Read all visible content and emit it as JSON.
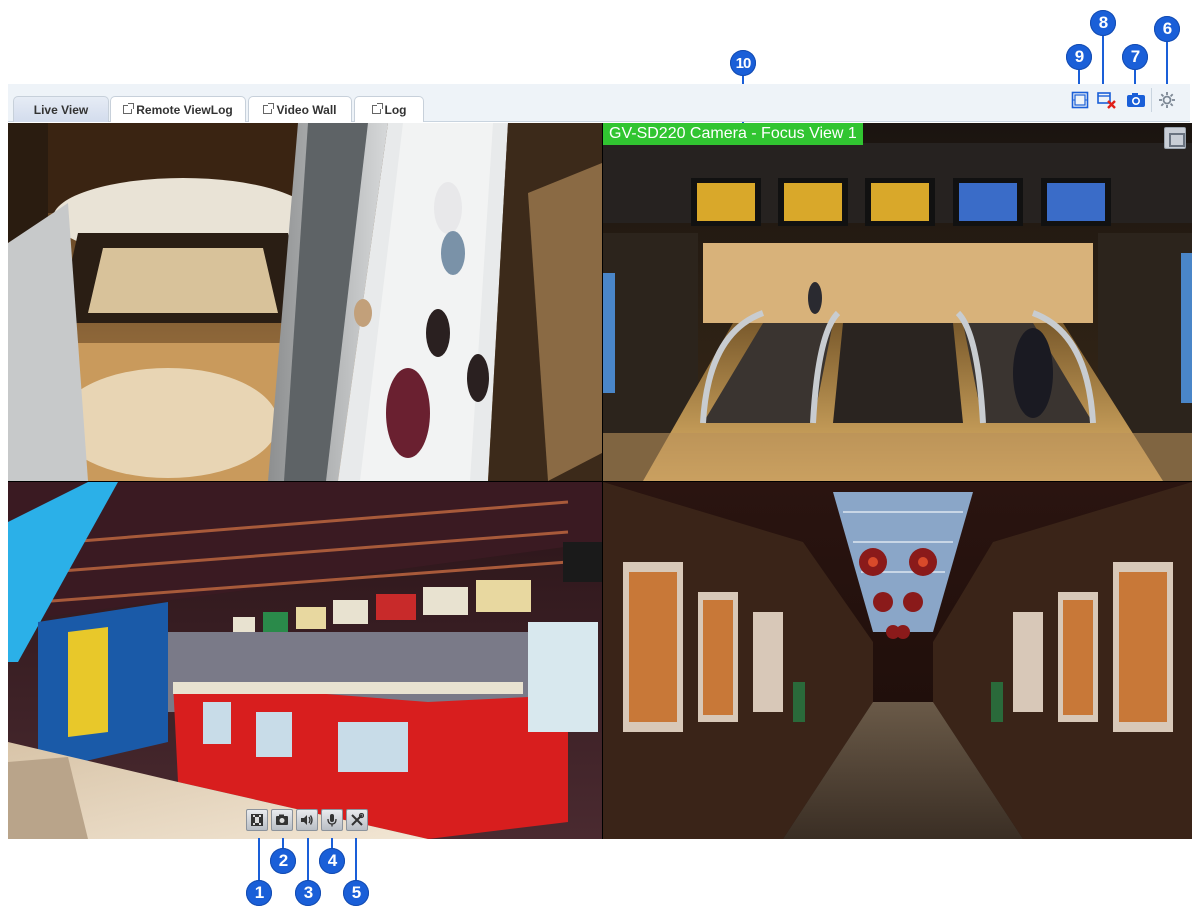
{
  "tabs": [
    {
      "label": "Live View",
      "active": true,
      "external": false
    },
    {
      "label": "Remote ViewLog",
      "active": false,
      "external": true
    },
    {
      "label": "Video Wall",
      "active": false,
      "external": true
    },
    {
      "label": "Log",
      "active": false,
      "external": true
    }
  ],
  "toolbar": {
    "icons": [
      "layout-icon",
      "close-all-icon",
      "snapshot-icon",
      "settings-icon"
    ]
  },
  "cameras": [
    {
      "title": ""
    },
    {
      "title": "GV-SD220 Camera - Focus View 1"
    },
    {
      "title": ""
    },
    {
      "title": ""
    }
  ],
  "cell_toolbar": {
    "icons": [
      "record-icon",
      "camera-icon",
      "speaker-icon",
      "microphone-icon",
      "tools-icon"
    ]
  },
  "markers": [
    "1",
    "2",
    "3",
    "4",
    "5",
    "6",
    "7",
    "8",
    "9",
    "10"
  ],
  "colors": {
    "marker": "#1a5fd8",
    "title_bar": "#31c531",
    "tab_bar": "#eef3f8"
  }
}
